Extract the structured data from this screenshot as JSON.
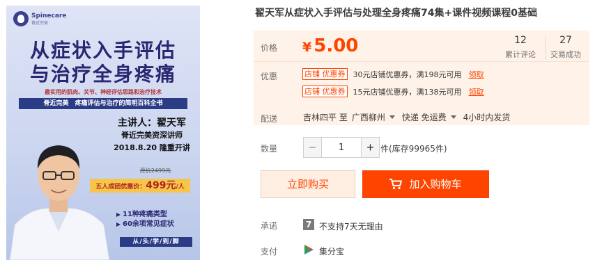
{
  "poster": {
    "brand": "Spinecare",
    "brand_sub": "脊近完美",
    "title_line1": "从症状入手评估",
    "title_line2": "与治疗全身疼痛",
    "subtitle": "最实用的肌肉、关节、神经评估思路和治疗技术",
    "band": "脊近完美　疼痛评估与治疗的简明百科全书",
    "speaker": "主讲人：翟天军",
    "speaker_role": "脊近完美资深讲师",
    "date": "2018.8.20 隆重开讲",
    "original_price": "原价2499元",
    "group_price_prefix": "五人成团优惠价：",
    "group_price_value": "499元",
    "group_price_unit": "/人",
    "feature1": "11种疼痛类型",
    "feature2": "60余项常见症状",
    "feature_strip": "从/头/学/到/脚"
  },
  "product": {
    "title": "翟天军从症状入手评估与处理全身疼痛74集+课件视频课程0基础"
  },
  "price": {
    "label": "价格",
    "currency": "¥",
    "value": "5.00",
    "reviews_count": "12",
    "reviews_label": "累计评论",
    "sales_count": "27",
    "sales_label": "交易成功"
  },
  "promo": {
    "label": "优惠",
    "coupons": [
      {
        "tag": "店铺 优惠券",
        "text": "30元店铺优惠券，满198元可用",
        "action": "领取"
      },
      {
        "tag": "店铺 优惠券",
        "text": "15元店铺优惠券，满138元可用",
        "action": "领取"
      }
    ]
  },
  "shipping": {
    "label": "配送",
    "from": "吉林四平 至",
    "to": "广西柳州",
    "method": "快递 免运费",
    "time": "4小时内发货"
  },
  "quantity": {
    "label": "数量",
    "value": "1",
    "minus": "−",
    "plus": "+",
    "stock": "件(库存99965件)"
  },
  "actions": {
    "buy_now": "立即购买",
    "add_to_cart": "加入购物车"
  },
  "promise": {
    "label": "承诺",
    "icon_glyph": "7",
    "text": "不支持7天无理由"
  },
  "payment": {
    "label": "支付",
    "method": "集分宝"
  },
  "colors": {
    "accent": "#ff4400",
    "panel_bg": "#fff2e8",
    "poster_navy": "#2b3c86"
  }
}
